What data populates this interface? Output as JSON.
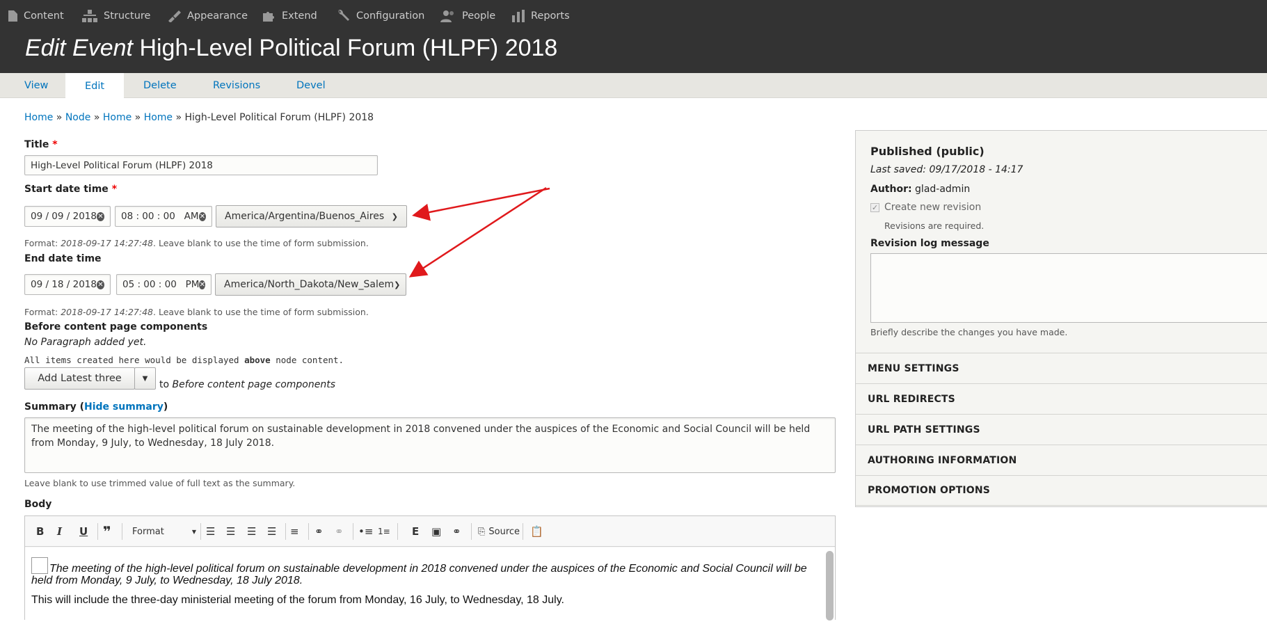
{
  "toolbar": {
    "items": [
      {
        "label": "Content",
        "icon": "file-icon"
      },
      {
        "label": "Structure",
        "icon": "structure-icon"
      },
      {
        "label": "Appearance",
        "icon": "brush-icon"
      },
      {
        "label": "Extend",
        "icon": "puzzle-icon"
      },
      {
        "label": "Configuration",
        "icon": "wrench-icon"
      },
      {
        "label": "People",
        "icon": "people-icon"
      },
      {
        "label": "Reports",
        "icon": "bar-chart-icon"
      }
    ]
  },
  "header": {
    "title_prefix": "Edit Event",
    "title": "High-Level Political Forum (HLPF) 2018"
  },
  "tabs": [
    {
      "label": "View"
    },
    {
      "label": "Edit",
      "active": true
    },
    {
      "label": "Delete"
    },
    {
      "label": "Revisions"
    },
    {
      "label": "Devel"
    }
  ],
  "breadcrumb": {
    "links": [
      "Home",
      "Node",
      "Home",
      "Home"
    ],
    "separator": "»",
    "current": "High-Level Political Forum (HLPF) 2018"
  },
  "form": {
    "title_label": "Title",
    "title_value": "High-Level Political Forum (HLPF) 2018",
    "required_mark": "*",
    "start": {
      "label": "Start date time",
      "date": "09 / 09 / 2018",
      "time": "08 : 00 : 00   AM",
      "timezone": "America/Argentina/Buenos_Aires"
    },
    "end": {
      "label": "End date time",
      "date": "09 / 18 / 2018",
      "time": "05 : 00 : 00   PM",
      "timezone": "America/North_Dakota/New_Salem"
    },
    "format_help_prefix": "Format: ",
    "format_example": "2018-09-17 14:27:48",
    "format_help_suffix": ". Leave blank to use the time of form submission.",
    "components_label": "Before content page components",
    "no_paragraph": "No Paragraph added yet.",
    "items_note_prefix": "All items created here would be displayed ",
    "items_note_bold": "above",
    "items_note_suffix": " node content.",
    "add_button": "Add Latest three",
    "add_to_prefix": "to ",
    "add_to_target": "Before content page components",
    "summary_label": "Summary (",
    "hide_summary": "Hide summary",
    "summary_label_close": ")",
    "summary_value_line1": "The meeting of the high-level political forum on sustainable development in 2018 convened under the auspices of the Economic and Social Council will be held",
    "summary_value_line2": "from Monday, 9 July, to Wednesday, 18 July 2018.",
    "summary_help": "Leave blank to use trimmed value of full text as the summary.",
    "body_label": "Body"
  },
  "editor": {
    "format_label": "Format",
    "source_label": "Source",
    "body_para1": "The meeting of the high-level political forum on sustainable development in 2018 convened under the auspices of the Economic and Social Council will be held from Monday, 9 July, to Wednesday, 18 July 2018.",
    "body_para2": "This will include the three-day ministerial meeting of the forum from Monday, 16 July, to Wednesday, 18 July."
  },
  "sidebar": {
    "status": "Published (public)",
    "last_saved": "Last saved: 09/17/2018 - 14:17",
    "author_label": "Author:",
    "author_value": "glad-admin",
    "create_revision": "Create new revision",
    "revisions_required": "Revisions are required.",
    "revision_log_label": "Revision log message",
    "revision_log_help": "Briefly describe the changes you have made.",
    "sections": [
      "Menu settings",
      "URL redirects",
      "URL path settings",
      "Authoring information",
      "Promotion options"
    ]
  },
  "colors": {
    "toolbar_bg": "#333333",
    "link": "#0074bd",
    "annotation_arrow": "#e0191c"
  }
}
